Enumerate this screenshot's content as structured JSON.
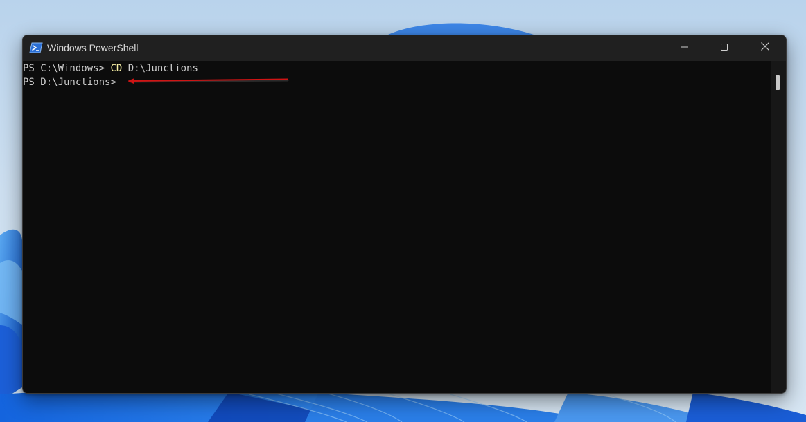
{
  "window": {
    "title": "Windows PowerShell",
    "app_icon": "powershell-icon",
    "controls": {
      "minimize_icon": "minimize-icon",
      "maximize_icon": "maximize-icon",
      "close_icon": "close-icon"
    }
  },
  "console": {
    "lines": [
      {
        "prompt": "PS C:\\Windows> ",
        "command": "CD",
        "args": " D:\\Junctions"
      },
      {
        "prompt": "PS D:\\Junctions> ",
        "command": "",
        "args": ""
      }
    ],
    "colors": {
      "background": "#0c0c0c",
      "text": "#cccccc",
      "command": "#f9f1a5"
    }
  },
  "annotation": {
    "type": "arrow",
    "color": "#d01414",
    "icon": "red-arrow-annotation"
  },
  "colors": {
    "titlebar": "#202020",
    "accent": "#1f5fcf"
  }
}
